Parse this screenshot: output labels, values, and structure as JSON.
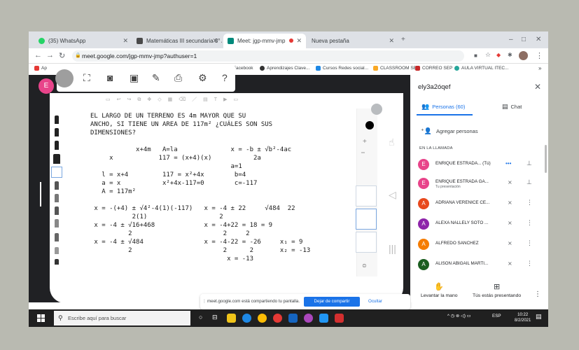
{
  "tabs": [
    {
      "label": "(35) WhatsApp",
      "color": "#25d366"
    },
    {
      "label": "Matemáticas III secundaria 3° A",
      "color": "#4a4a4a"
    },
    {
      "label": "Meet: jgp-mmv-jmp",
      "color": "#00897b",
      "recording": true
    },
    {
      "label": "Nueva pestaña",
      "color": "#ffffff"
    }
  ],
  "address_bar": {
    "url": "meet.google.com/jgp-mmv-jmp?authuser=1"
  },
  "bookmarks": [
    {
      "label": "Ap",
      "color": "#e53935"
    },
    {
      "label": "Facebook",
      "color": "#1877f2"
    },
    {
      "label": "Aprendizajes Clave...",
      "color": "#333333"
    },
    {
      "label": "Cursos Redes social...",
      "color": "#1e88e5"
    },
    {
      "label": "CLASSROOM SEP",
      "color": "#f9a825"
    },
    {
      "label": "CORREO SEP",
      "color": "#c62828"
    },
    {
      "label": "AULA VIRTUAL ITEC...",
      "color": "#26a69a"
    }
  ],
  "meet": {
    "self_avatar": "E",
    "whiteboard_content": [
      "EL LARGO DE UN TERRENO ES 4m MAYOR QUE SU",
      "ANCHO, SI TIENE UN AREA DE 117m² ¿CUÁLES SON SUS",
      "DIMENSIONES?",
      "",
      "            x+4m   A=la              x = -b ± √b²-4ac",
      "     x            117 = (x+4)(x)           2a",
      "                                     a=1",
      "   l = x+4         117 = x²+4x        b=4",
      "   a = x           x²+4x-117=0        c=-117",
      "   A = 117m²",
      "",
      " x = -(+4) ± √4²-4(1)(-117)   x = -4 ± 22     √484  22",
      "           2(1)                   2",
      " x = -4 ± √16+468             x = -4+22 = 18 = 9",
      "          2                        2     2",
      " x = -4 ± √484                x = -4-22 = -26     x₁ = 9",
      "          2                        2      2       x₂ = -13",
      "                                    x = -13"
    ],
    "share_bar": {
      "message": "meet.google.com está compartiendo tu pantalla.",
      "stop_label": "Dejar de compartir",
      "hide_label": "Ocultar"
    }
  },
  "panel": {
    "title": "ely3a2óqef",
    "tab_people": "Personas (60)",
    "tab_chat": "Chat",
    "add_people": "Agregar personas",
    "section_label": "EN LA LLAMADA",
    "participants": [
      {
        "initial": "E",
        "name": "ENRIQUE ESTRADA... (Tú)",
        "sub": "",
        "color": "#e8448a"
      },
      {
        "initial": "E",
        "name": "ENRIQUE ESTRADA GA...",
        "sub": "Tu presentación",
        "color": "#e8448a"
      },
      {
        "initial": "A",
        "name": "ADRIANA VERENICE CE...",
        "sub": "",
        "color": "#e8491d"
      },
      {
        "initial": "A",
        "name": "ALEXA NALLELY SOTO ...",
        "sub": "",
        "color": "#8e24aa"
      },
      {
        "initial": "A",
        "name": "ALFREDO SANCHEZ",
        "sub": "",
        "color": "#f57c00"
      },
      {
        "initial": "A",
        "name": "ALISON ABIGAIL MARTI...",
        "sub": "",
        "color": "#1b5e20"
      }
    ],
    "actions": [
      {
        "label": "Levantar la mano"
      },
      {
        "label": "Tús estás presentando"
      }
    ]
  },
  "taskbar": {
    "search_placeholder": "Escribe aquí para buscar",
    "language": "ESP",
    "time": "10:22",
    "date": "8/2/2021"
  }
}
